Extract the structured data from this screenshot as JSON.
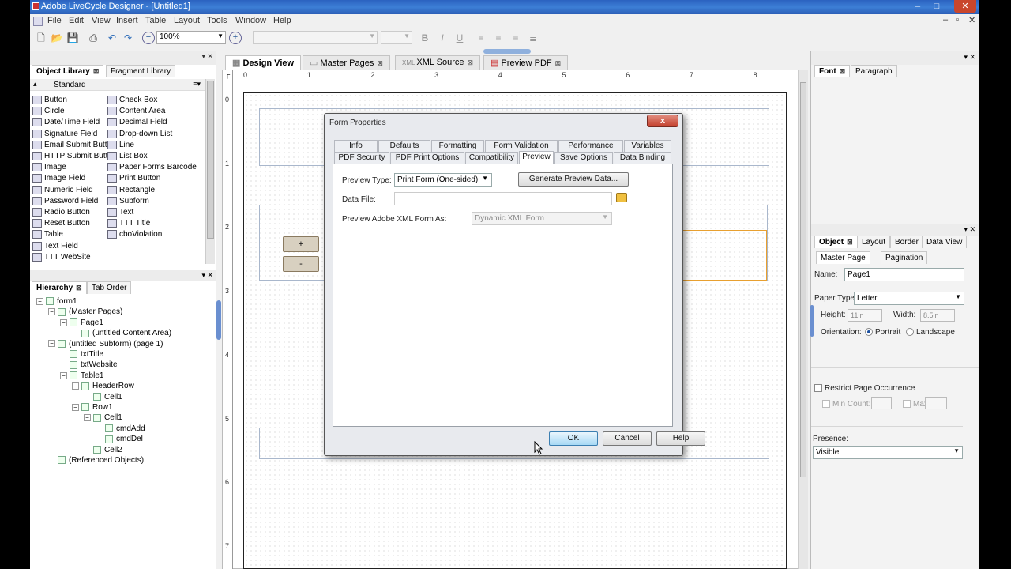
{
  "window": {
    "title": "Adobe LiveCycle Designer - [Untitled1]",
    "min": "–",
    "max": "□",
    "close": "✕"
  },
  "menu": [
    "File",
    "Edit",
    "View",
    "Insert",
    "Table",
    "Layout",
    "Tools",
    "Window",
    "Help"
  ],
  "toolbar": {
    "zoom": "100%",
    "bold": "B",
    "italic": "I",
    "underline": "U"
  },
  "object_library": {
    "tabs": [
      "Object Library",
      "Fragment Library"
    ],
    "group": "Standard",
    "items_left": [
      "Button",
      "Circle",
      "Date/Time Field",
      "Signature Field",
      "Email Submit Button",
      "HTTP Submit Button",
      "Image",
      "Image Field",
      "Numeric Field",
      "Password Field",
      "Radio Button",
      "Reset Button",
      "Table",
      "Text Field",
      "TTT WebSite"
    ],
    "items_right": [
      "Check Box",
      "Content Area",
      "Decimal Field",
      "Drop-down List",
      "Line",
      "List Box",
      "Paper Forms Barcode",
      "Print Button",
      "Rectangle",
      "Subform",
      "Text",
      "TTT Title",
      "cboViolation"
    ]
  },
  "hierarchy": {
    "tabs": [
      "Hierarchy",
      "Tab Order"
    ],
    "nodes": [
      "form1",
      "(Master Pages)",
      "Page1",
      "(untitled Content Area)",
      "(untitled Subform) (page 1)",
      "txtTitle",
      "txtWebsite",
      "Table1",
      "HeaderRow",
      "Cell1",
      "Row1",
      "Cell1",
      "cmdAdd",
      "cmdDel",
      "Cell2",
      "(Referenced Objects)"
    ]
  },
  "doc_tabs": [
    "Design View",
    "Master Pages",
    "XML Source",
    "Preview PDF"
  ],
  "ruler": {
    "h": [
      "0",
      "1",
      "2",
      "3",
      "4",
      "5",
      "6",
      "7",
      "8"
    ],
    "v": [
      "0",
      "1",
      "2",
      "3",
      "4",
      "5",
      "6",
      "7"
    ]
  },
  "canvas": {
    "plus": "+",
    "minus": "-"
  },
  "dialog": {
    "title": "Form Properties",
    "close": "x",
    "tabs_row1": [
      "Info",
      "Defaults",
      "Formatting",
      "Form Validation",
      "Performance",
      "Variables"
    ],
    "tabs_row2": [
      "PDF Security",
      "PDF Print Options",
      "Compatibility",
      "Preview",
      "Save Options",
      "Data Binding"
    ],
    "preview_type_label": "Preview Type:",
    "preview_type_value": "Print Form (One-sided)",
    "generate_button": "Generate Preview Data...",
    "data_file_label": "Data File:",
    "data_file_value": "",
    "preview_as_label": "Preview Adobe XML Form As:",
    "preview_as_value": "Dynamic XML Form",
    "ok": "OK",
    "cancel": "Cancel",
    "help": "Help"
  },
  "font_panel": {
    "tabs": [
      "Font",
      "Paragraph"
    ]
  },
  "object_panel": {
    "tabs": [
      "Object",
      "Layout",
      "Border",
      "Data View"
    ],
    "subtabs": [
      "Master Page",
      "Pagination"
    ],
    "name_label": "Name:",
    "name_value": "Page1",
    "paper_type_label": "Paper Type:",
    "paper_type_value": "Letter",
    "height_label": "Height:",
    "height_value": "11in",
    "width_label": "Width:",
    "width_value": "8.5in",
    "orientation_label": "Orientation:",
    "portrait": "Portrait",
    "landscape": "Landscape",
    "restrict": "Restrict Page Occurrence",
    "min_count": "Min Count:",
    "max": "Max:",
    "presence_label": "Presence:",
    "presence_value": "Visible"
  }
}
